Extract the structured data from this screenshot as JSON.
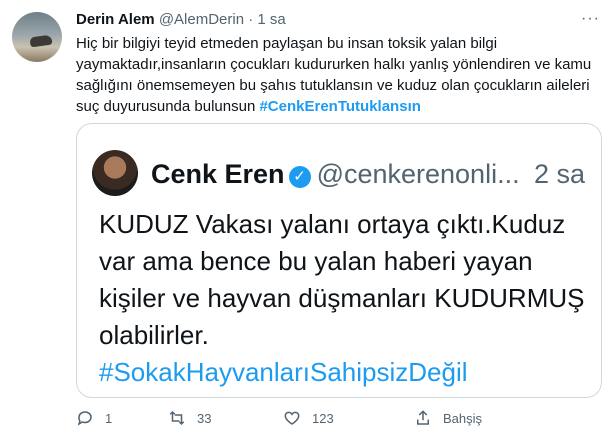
{
  "tweet": {
    "author_name": "Derin Alem",
    "author_handle": "@AlemDerin",
    "separator": "·",
    "time": "1 sa",
    "more_label": "···",
    "text": "Hiç bir bilgiyi teyid etmeden paylaşan bu insan toksik yalan bilgi yaymaktadır,insanların çocukları kudururken halkı yanlış yönlendiren ve kamu sağlığını önemsemeyen bu şahıs tutuklansın ve kuduz olan çocukların aileleri suç duyurusunda bulunsun",
    "hashtag": "#CenkErenTutuklansın"
  },
  "quoted": {
    "author_name": "Cenk Eren",
    "author_handle": "@cenkerenonli...",
    "time": "2 sa",
    "text": "KUDUZ Vakası yalanı ortaya çıktı.Kuduz var ama bence bu yalan haberi yayan kişiler ve hayvan düşmanları KUDURMUŞ olabilirler.",
    "hashtag": "#SokakHayvanlarıSahipsizDeğil"
  },
  "actions": {
    "reply_count": "1",
    "retweet_count": "33",
    "like_count": "123",
    "share_label": "Bahşiş"
  },
  "colors": {
    "link": "#1d9bf0",
    "secondary": "#536471",
    "text": "#0f1419",
    "border": "#cfd9de"
  }
}
